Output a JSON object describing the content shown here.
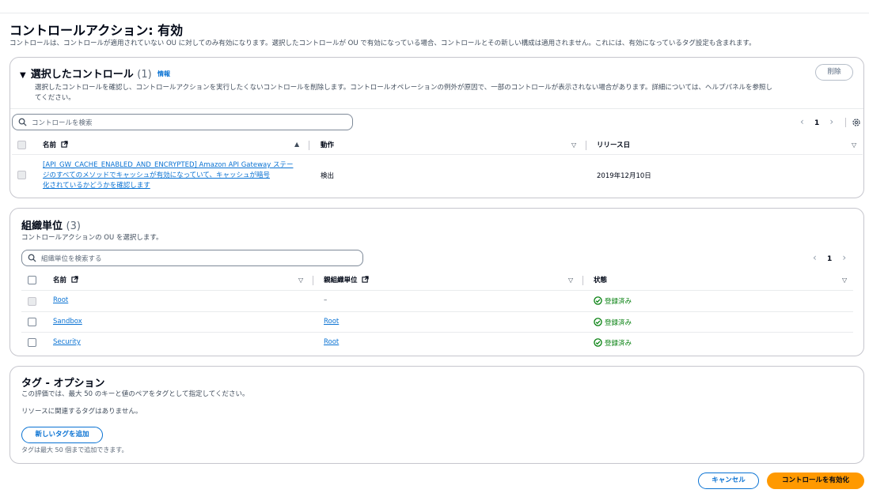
{
  "page": {
    "title": "コントロールアクション: 有効",
    "description": "コントロールは、コントロールが適用されていない OU に対してのみ有効になります。選択したコントロールが OU で有効になっている場合、コントロールとその新しい構成は適用されません。これには、有効になっているタグ設定も含まれます。"
  },
  "selected_controls": {
    "title": "選択したコントロール",
    "count": "(1)",
    "info": "情報",
    "description_line1": "選択したコントロールを確認し、コントロールアクションを実行したくないコントロールを削除します。コントロールオペレーションの例外が原因で、一部のコントロールが表示されない場合があります。詳細については、ヘルプパネルを参照し",
    "description_line2": "てください。",
    "delete_label": "削除",
    "search_placeholder": "コントロールを検索",
    "page_number": "1",
    "columns": {
      "name": "名前",
      "action": "動作",
      "release": "リリース日"
    },
    "rows": [
      {
        "name_line1": "[API_GW_CACHE_ENABLED_AND_ENCRYPTED] Amazon API Gateway ステー",
        "name_line2": "ジのすべてのメソッドでキャッシュが有効になっていて、キャッシュが暗号",
        "name_line3": "化されているかどうかを確認します",
        "action": "検出",
        "release": "2019年12月10日"
      }
    ]
  },
  "ous": {
    "title": "組織単位",
    "count": "(3)",
    "description": "コントロールアクションの OU を選択します。",
    "search_placeholder": "組織単位を検索する",
    "page_number": "1",
    "columns": {
      "name": "名前",
      "parent": "親組織単位",
      "status": "状態"
    },
    "rows": [
      {
        "name": "Root",
        "parent": "–",
        "status": "登録済み"
      },
      {
        "name": "Sandbox",
        "parent": "Root",
        "status": "登録済み"
      },
      {
        "name": "Security",
        "parent": "Root",
        "status": "登録済み"
      }
    ]
  },
  "tags": {
    "title": "タグ - オプション",
    "description": "この評価では、最大 50 のキーと値のペアをタグとして指定してください。",
    "empty": "リソースに関連するタグはありません。",
    "add_label": "新しいタグを追加",
    "limit_note": "タグは最大 50 個まで追加できます。"
  },
  "footer": {
    "cancel_label": "キャンセル",
    "enable_label": "コントロールを有効化"
  },
  "colors": {
    "accent": "#0972d3",
    "primary": "#ff9900",
    "success": "#037f0c"
  }
}
